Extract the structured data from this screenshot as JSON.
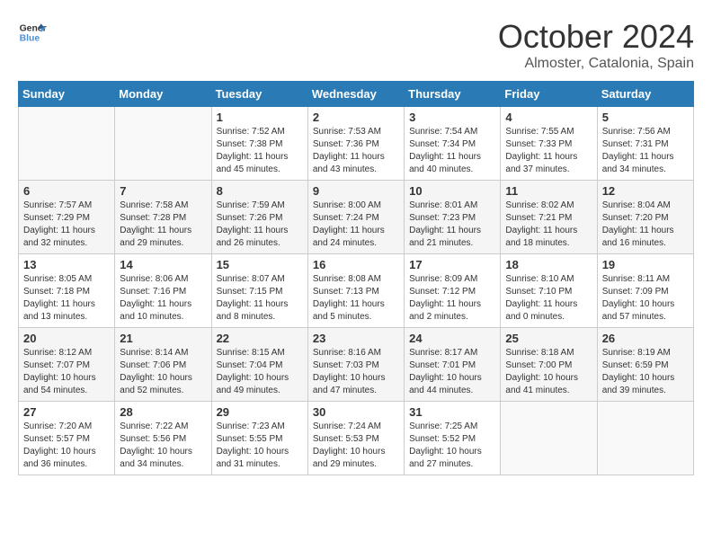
{
  "header": {
    "logo_general": "General",
    "logo_blue": "Blue",
    "month": "October 2024",
    "location": "Almoster, Catalonia, Spain"
  },
  "weekdays": [
    "Sunday",
    "Monday",
    "Tuesday",
    "Wednesday",
    "Thursday",
    "Friday",
    "Saturday"
  ],
  "weeks": [
    [
      {
        "day": "",
        "empty": true
      },
      {
        "day": "",
        "empty": true
      },
      {
        "day": "1",
        "sunrise": "Sunrise: 7:52 AM",
        "sunset": "Sunset: 7:38 PM",
        "daylight": "Daylight: 11 hours and 45 minutes."
      },
      {
        "day": "2",
        "sunrise": "Sunrise: 7:53 AM",
        "sunset": "Sunset: 7:36 PM",
        "daylight": "Daylight: 11 hours and 43 minutes."
      },
      {
        "day": "3",
        "sunrise": "Sunrise: 7:54 AM",
        "sunset": "Sunset: 7:34 PM",
        "daylight": "Daylight: 11 hours and 40 minutes."
      },
      {
        "day": "4",
        "sunrise": "Sunrise: 7:55 AM",
        "sunset": "Sunset: 7:33 PM",
        "daylight": "Daylight: 11 hours and 37 minutes."
      },
      {
        "day": "5",
        "sunrise": "Sunrise: 7:56 AM",
        "sunset": "Sunset: 7:31 PM",
        "daylight": "Daylight: 11 hours and 34 minutes."
      }
    ],
    [
      {
        "day": "6",
        "sunrise": "Sunrise: 7:57 AM",
        "sunset": "Sunset: 7:29 PM",
        "daylight": "Daylight: 11 hours and 32 minutes."
      },
      {
        "day": "7",
        "sunrise": "Sunrise: 7:58 AM",
        "sunset": "Sunset: 7:28 PM",
        "daylight": "Daylight: 11 hours and 29 minutes."
      },
      {
        "day": "8",
        "sunrise": "Sunrise: 7:59 AM",
        "sunset": "Sunset: 7:26 PM",
        "daylight": "Daylight: 11 hours and 26 minutes."
      },
      {
        "day": "9",
        "sunrise": "Sunrise: 8:00 AM",
        "sunset": "Sunset: 7:24 PM",
        "daylight": "Daylight: 11 hours and 24 minutes."
      },
      {
        "day": "10",
        "sunrise": "Sunrise: 8:01 AM",
        "sunset": "Sunset: 7:23 PM",
        "daylight": "Daylight: 11 hours and 21 minutes."
      },
      {
        "day": "11",
        "sunrise": "Sunrise: 8:02 AM",
        "sunset": "Sunset: 7:21 PM",
        "daylight": "Daylight: 11 hours and 18 minutes."
      },
      {
        "day": "12",
        "sunrise": "Sunrise: 8:04 AM",
        "sunset": "Sunset: 7:20 PM",
        "daylight": "Daylight: 11 hours and 16 minutes."
      }
    ],
    [
      {
        "day": "13",
        "sunrise": "Sunrise: 8:05 AM",
        "sunset": "Sunset: 7:18 PM",
        "daylight": "Daylight: 11 hours and 13 minutes."
      },
      {
        "day": "14",
        "sunrise": "Sunrise: 8:06 AM",
        "sunset": "Sunset: 7:16 PM",
        "daylight": "Daylight: 11 hours and 10 minutes."
      },
      {
        "day": "15",
        "sunrise": "Sunrise: 8:07 AM",
        "sunset": "Sunset: 7:15 PM",
        "daylight": "Daylight: 11 hours and 8 minutes."
      },
      {
        "day": "16",
        "sunrise": "Sunrise: 8:08 AM",
        "sunset": "Sunset: 7:13 PM",
        "daylight": "Daylight: 11 hours and 5 minutes."
      },
      {
        "day": "17",
        "sunrise": "Sunrise: 8:09 AM",
        "sunset": "Sunset: 7:12 PM",
        "daylight": "Daylight: 11 hours and 2 minutes."
      },
      {
        "day": "18",
        "sunrise": "Sunrise: 8:10 AM",
        "sunset": "Sunset: 7:10 PM",
        "daylight": "Daylight: 11 hours and 0 minutes."
      },
      {
        "day": "19",
        "sunrise": "Sunrise: 8:11 AM",
        "sunset": "Sunset: 7:09 PM",
        "daylight": "Daylight: 10 hours and 57 minutes."
      }
    ],
    [
      {
        "day": "20",
        "sunrise": "Sunrise: 8:12 AM",
        "sunset": "Sunset: 7:07 PM",
        "daylight": "Daylight: 10 hours and 54 minutes."
      },
      {
        "day": "21",
        "sunrise": "Sunrise: 8:14 AM",
        "sunset": "Sunset: 7:06 PM",
        "daylight": "Daylight: 10 hours and 52 minutes."
      },
      {
        "day": "22",
        "sunrise": "Sunrise: 8:15 AM",
        "sunset": "Sunset: 7:04 PM",
        "daylight": "Daylight: 10 hours and 49 minutes."
      },
      {
        "day": "23",
        "sunrise": "Sunrise: 8:16 AM",
        "sunset": "Sunset: 7:03 PM",
        "daylight": "Daylight: 10 hours and 47 minutes."
      },
      {
        "day": "24",
        "sunrise": "Sunrise: 8:17 AM",
        "sunset": "Sunset: 7:01 PM",
        "daylight": "Daylight: 10 hours and 44 minutes."
      },
      {
        "day": "25",
        "sunrise": "Sunrise: 8:18 AM",
        "sunset": "Sunset: 7:00 PM",
        "daylight": "Daylight: 10 hours and 41 minutes."
      },
      {
        "day": "26",
        "sunrise": "Sunrise: 8:19 AM",
        "sunset": "Sunset: 6:59 PM",
        "daylight": "Daylight: 10 hours and 39 minutes."
      }
    ],
    [
      {
        "day": "27",
        "sunrise": "Sunrise: 7:20 AM",
        "sunset": "Sunset: 5:57 PM",
        "daylight": "Daylight: 10 hours and 36 minutes."
      },
      {
        "day": "28",
        "sunrise": "Sunrise: 7:22 AM",
        "sunset": "Sunset: 5:56 PM",
        "daylight": "Daylight: 10 hours and 34 minutes."
      },
      {
        "day": "29",
        "sunrise": "Sunrise: 7:23 AM",
        "sunset": "Sunset: 5:55 PM",
        "daylight": "Daylight: 10 hours and 31 minutes."
      },
      {
        "day": "30",
        "sunrise": "Sunrise: 7:24 AM",
        "sunset": "Sunset: 5:53 PM",
        "daylight": "Daylight: 10 hours and 29 minutes."
      },
      {
        "day": "31",
        "sunrise": "Sunrise: 7:25 AM",
        "sunset": "Sunset: 5:52 PM",
        "daylight": "Daylight: 10 hours and 27 minutes."
      },
      {
        "day": "",
        "empty": true
      },
      {
        "day": "",
        "empty": true
      }
    ]
  ]
}
